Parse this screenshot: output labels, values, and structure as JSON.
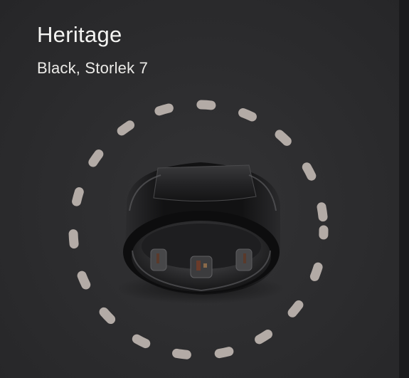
{
  "product": {
    "name": "Heritage",
    "variant": "Black, Storlek 7"
  },
  "colors": {
    "background": "#2d2d2f",
    "dash_ring": "#b3aba6",
    "ring_metal": "#1a1a1c",
    "text": "#f4f4f2"
  }
}
